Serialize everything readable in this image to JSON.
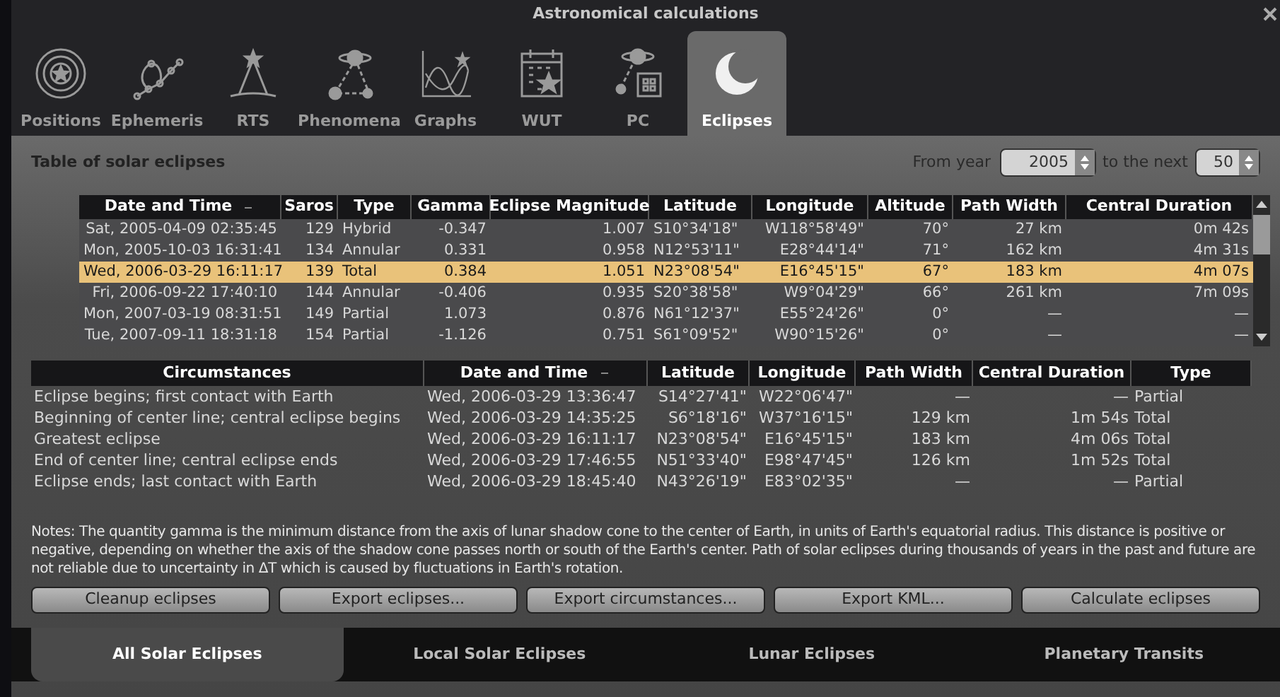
{
  "window": {
    "title": "Astronomical calculations"
  },
  "tabs": [
    {
      "label": "Positions",
      "selected": false
    },
    {
      "label": "Ephemeris",
      "selected": false
    },
    {
      "label": "RTS",
      "selected": false
    },
    {
      "label": "Phenomena",
      "selected": false
    },
    {
      "label": "Graphs",
      "selected": false
    },
    {
      "label": "WUT",
      "selected": false
    },
    {
      "label": "PC",
      "selected": false
    },
    {
      "label": "Eclipses",
      "selected": true
    }
  ],
  "panel": {
    "title": "Table of solar eclipses",
    "from_label": "From year",
    "from_value": "2005",
    "next_label": "to the next",
    "next_value": "50"
  },
  "eclipses_table": {
    "columns": [
      "Date and Time",
      "Saros",
      "Type",
      "Gamma",
      "Eclipse Magnitude",
      "Latitude",
      "Longitude",
      "Altitude",
      "Path Width",
      "Central Duration"
    ],
    "rows": [
      {
        "selected": false,
        "cells": [
          "Sat, 2005-04-09 02:35:45",
          "129",
          "Hybrid",
          "-0.347",
          "1.007",
          "S10°34'18\"",
          "W118°58'49\"",
          "70°",
          "27 km",
          "0m 42s"
        ]
      },
      {
        "selected": false,
        "cells": [
          "Mon, 2005-10-03 16:31:41",
          "134",
          "Annular",
          "0.331",
          "0.958",
          "N12°53'11\"",
          "E28°44'14\"",
          "71°",
          "162 km",
          "4m 31s"
        ]
      },
      {
        "selected": true,
        "cells": [
          "Wed, 2006-03-29 16:11:17",
          "139",
          "Total",
          "0.384",
          "1.051",
          "N23°08'54\"",
          "E16°45'15\"",
          "67°",
          "183 km",
          "4m 07s"
        ]
      },
      {
        "selected": false,
        "cells": [
          "Fri, 2006-09-22 17:40:10",
          "144",
          "Annular",
          "-0.406",
          "0.935",
          "S20°38'58\"",
          "W9°04'29\"",
          "66°",
          "261 km",
          "7m 09s"
        ]
      },
      {
        "selected": false,
        "cells": [
          "Mon, 2007-03-19 08:31:51",
          "149",
          "Partial",
          "1.073",
          "0.876",
          "N61°12'37\"",
          "E55°24'26\"",
          "0°",
          "—",
          "—"
        ]
      },
      {
        "selected": false,
        "cells": [
          "Tue, 2007-09-11 18:31:18",
          "154",
          "Partial",
          "-1.126",
          "0.751",
          "S61°09'52\"",
          "W90°15'26\"",
          "0°",
          "—",
          "—"
        ]
      }
    ]
  },
  "circumstances_table": {
    "columns": [
      "Circumstances",
      "Date and Time",
      "Latitude",
      "Longitude",
      "Path Width",
      "Central Duration",
      "Type"
    ],
    "rows": [
      [
        "Eclipse begins; first contact with Earth",
        "Wed, 2006-03-29 13:36:47",
        "S14°27'41\"",
        "W22°06'47\"",
        "—",
        "—",
        "Partial"
      ],
      [
        "Beginning of center line; central eclipse begins",
        "Wed, 2006-03-29 14:35:25",
        "S6°18'16\"",
        "W37°16'15\"",
        "129 km",
        "1m 54s",
        "Total"
      ],
      [
        "Greatest eclipse",
        "Wed, 2006-03-29 16:11:17",
        "N23°08'54\"",
        "E16°45'15\"",
        "183 km",
        "4m 06s",
        "Total"
      ],
      [
        "End of center line; central eclipse ends",
        "Wed, 2006-03-29 17:46:55",
        "N51°33'40\"",
        "E98°47'45\"",
        "126 km",
        "1m 52s",
        "Total"
      ],
      [
        "Eclipse ends; last contact with Earth",
        "Wed, 2006-03-29 18:45:40",
        "N43°26'19\"",
        "E83°02'35\"",
        "—",
        "—",
        "Partial"
      ]
    ]
  },
  "notes": "Notes: The quantity gamma is the minimum distance from the axis of lunar shadow cone to the center of Earth, in units of Earth's equatorial radius. This distance is positive or negative, depending on whether the axis of the shadow cone passes north or south of the Earth's center. Path of solar eclipses during thousands of years in the past and future are not reliable due to uncertainty in ΔT which is caused by fluctuations in Earth's rotation.",
  "buttons": [
    "Cleanup eclipses",
    "Export eclipses...",
    "Export circumstances...",
    "Export KML...",
    "Calculate eclipses"
  ],
  "bottom_tabs": [
    {
      "label": "All Solar Eclipses",
      "selected": true
    },
    {
      "label": "Local Solar Eclipses",
      "selected": false
    },
    {
      "label": "Lunar Eclipses",
      "selected": false
    },
    {
      "label": "Planetary Transits",
      "selected": false
    }
  ]
}
